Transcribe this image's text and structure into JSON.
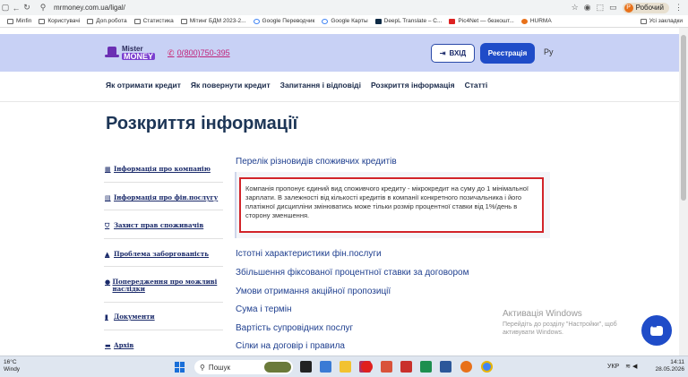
{
  "browser": {
    "url": "mrmoney.com.ua/ligal/",
    "profile_name": "Робочий",
    "profile_initial": "Р",
    "bookmarks": [
      {
        "label": "Minfin",
        "icon": "folder-icon"
      },
      {
        "label": "Користувачі",
        "icon": "folder-icon"
      },
      {
        "label": "Доп.робота",
        "icon": "folder-icon"
      },
      {
        "label": "Статистика",
        "icon": "folder-icon"
      },
      {
        "label": "Мітинг БДМ 2023-2...",
        "icon": "folder-icon"
      },
      {
        "label": "Google Переводчик",
        "icon": "google-translate-icon"
      },
      {
        "label": "Google Карты",
        "icon": "google-maps-icon"
      },
      {
        "label": "DeepL Translate – С...",
        "icon": "deepl-icon"
      },
      {
        "label": "Pic4Net — безкошт...",
        "icon": "pic4net-icon"
      },
      {
        "label": "HURMA",
        "icon": "hurma-icon"
      }
    ],
    "bookmarks_right": "Усі закладки"
  },
  "header": {
    "logo_line1": "Mister",
    "logo_line2": "MONEY",
    "phone": "0(800)750-395",
    "login_label": "ВХІД",
    "register_label": "Реєстрація",
    "lang": "Ру"
  },
  "nav": {
    "items": [
      "Як отримати кредит",
      "Як повернути кредит",
      "Запитання і відповіді",
      "Розкриття інформація",
      "Статті"
    ]
  },
  "page": {
    "title": "Розкриття інформації"
  },
  "sidebar": {
    "items": [
      {
        "label": "Інформація про компанію",
        "icon": "building-icon"
      },
      {
        "label": "Інформація про фін.послугу",
        "icon": "document-icon"
      },
      {
        "label": "Захист прав споживачів",
        "icon": "shield-icon"
      },
      {
        "label": "Проблема заборгованість",
        "icon": "warning-icon"
      },
      {
        "label": "Попередження про можливі наслідки",
        "icon": "info-icon"
      },
      {
        "label": "Документи",
        "icon": "file-icon"
      },
      {
        "label": "Архів",
        "icon": "archive-icon"
      }
    ]
  },
  "content": {
    "section_title": "Перелік різновидів споживчих кредитів",
    "info_text": "Компанія пропонує єдиний вид споживчого кредиту - мікрокредит на суму до 1 мінімальної зарплати. В залежності від кількості кредитів в компанії конкретного позичальника і його платіжної дисципліни змінюватись може тільки розмір процентної ставки від 1%/день в сторону зменшення.",
    "links": [
      "Істотні характеристики фін.послуги",
      "Збільшення фіксованої процентної ставки за договором",
      "Умови отримання акційної пропозиції",
      "Сума і термін",
      "Вартість супровідних послуг",
      "Сілки на договір і правила"
    ]
  },
  "activation": {
    "title": "Активація Windows",
    "subtitle": "Перейдіть до розділу \"Настройки\", щоб активувати Windows."
  },
  "taskbar": {
    "temp": "16°C",
    "weather": "Windy",
    "search_placeholder": "Пошук",
    "lang": "УКР",
    "time": "14:11",
    "date": "28.05.2026"
  }
}
